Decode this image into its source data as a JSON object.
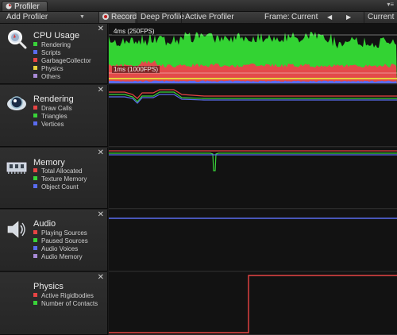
{
  "window": {
    "tab_title": "Profiler",
    "menu_glyph": "▾≡"
  },
  "toolbar": {
    "add_profiler": "Add Profiler",
    "record": "Record",
    "deep_profile": "Deep Profile",
    "active_profiler": "Active Profiler",
    "frame_label": "Frame:",
    "frame_value": "Current",
    "prev_glyph": "◀",
    "next_glyph": "▶",
    "current_button": "Current"
  },
  "colors": {
    "red": "#e84444",
    "green": "#39d339",
    "blue": "#5a6cf0",
    "yellow": "#e6d23c",
    "purple": "#a88ad6",
    "cpu_fill_green": "#33d333",
    "cpu_fill_red": "#e34a4a"
  },
  "modules": {
    "cpu": {
      "title": "CPU Usage",
      "icon": "cpu-magnifier-icon",
      "legend": [
        {
          "label": "Rendering",
          "color": "#39d339"
        },
        {
          "label": "Scripts",
          "color": "#5a6cf0"
        },
        {
          "label": "GarbageCollector",
          "color": "#e84444"
        },
        {
          "label": "Physics",
          "color": "#e6d23c"
        },
        {
          "label": "Others",
          "color": "#a88ad6"
        }
      ],
      "label_top": "4ms (250FPS)",
      "label_bottom": "1ms (1000FPS)"
    },
    "rendering": {
      "title": "Rendering",
      "icon": "eye-sphere-icon",
      "legend": [
        {
          "label": "Draw Calls",
          "color": "#e84444"
        },
        {
          "label": "Triangles",
          "color": "#39d339"
        },
        {
          "label": "Vertices",
          "color": "#5a6cf0"
        }
      ]
    },
    "memory": {
      "title": "Memory",
      "icon": "memory-chip-icon",
      "legend": [
        {
          "label": "Total Allocated",
          "color": "#e84444"
        },
        {
          "label": "Texture Memory",
          "color": "#39d339"
        },
        {
          "label": "Object Count",
          "color": "#5a6cf0"
        }
      ]
    },
    "audio": {
      "title": "Audio",
      "icon": "speaker-icon",
      "legend": [
        {
          "label": "Playing Sources",
          "color": "#e84444"
        },
        {
          "label": "Paused Sources",
          "color": "#39d339"
        },
        {
          "label": "Audio Voices",
          "color": "#5a6cf0"
        },
        {
          "label": "Audio Memory",
          "color": "#a88ad6"
        }
      ]
    },
    "physics": {
      "title": "Physics",
      "icon": "none",
      "legend": [
        {
          "label": "Active Rigidbodies",
          "color": "#e84444"
        },
        {
          "label": "Number of Contacts",
          "color": "#39d339"
        }
      ]
    }
  }
}
